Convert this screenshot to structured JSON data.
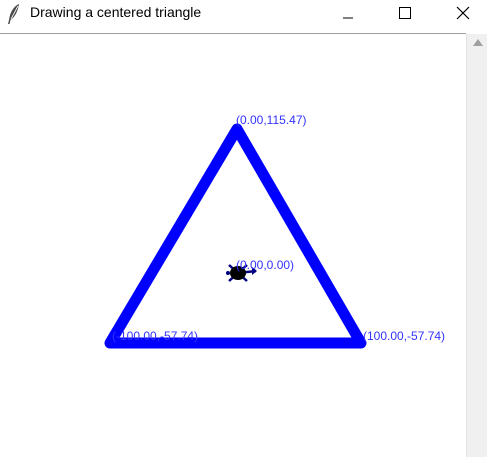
{
  "window": {
    "title": "Drawing a centered triangle",
    "icon": "feather-icon",
    "controls": {
      "minimize_icon": "minimize-icon",
      "maximize_icon": "maximize-icon",
      "close_icon": "close-icon"
    }
  },
  "canvas": {
    "line_color": "#0000ff",
    "label_color": "#3333ff",
    "vertices": [
      {
        "label": "(0.00,115.47)"
      },
      {
        "label": "(-100.00,-57.74)"
      },
      {
        "label": "(100.00,-57.74)"
      }
    ],
    "center_label": "(0.00,0.00)",
    "turtle_icon": "turtle-icon"
  },
  "scrollbar": {
    "up_icon": "scroll-up-arrow-icon"
  }
}
